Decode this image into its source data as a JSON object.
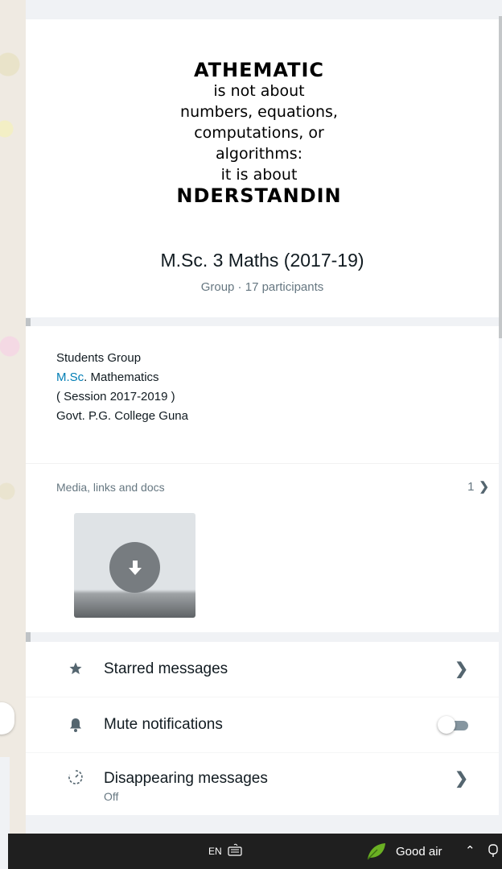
{
  "poster": {
    "line1": "ATHEMATIC",
    "line2": "is not about",
    "line3": "numbers, equations,",
    "line4": "computations, or",
    "line5": "algorithms:",
    "line6": "it is about",
    "line7": "NDERSTANDIN"
  },
  "group": {
    "title": "M.Sc. 3 Maths (2017-19)",
    "subtitle": "Group · 17 participants"
  },
  "description": {
    "line1": "Students Group",
    "line2_link": "M.Sc",
    "line2_rest": ". Mathematics",
    "line3": "( Session 2017-2019 )",
    "line4": "Govt. P.G. College Guna"
  },
  "media": {
    "label": "Media, links and docs",
    "count": "1",
    "thumb_icon": "download-icon"
  },
  "actions": {
    "starred_label": "Starred messages",
    "starred_icon": "star-icon",
    "mute_label": "Mute notifications",
    "mute_icon": "bell-icon",
    "mute_on": false,
    "disappearing_label": "Disappearing messages",
    "disappearing_sub": "Off",
    "disappearing_icon": "timer-icon"
  },
  "taskbar": {
    "language": "EN",
    "air_quality": "Good air",
    "colors": {
      "bar": "#1f1f1f",
      "leaf": "#6ab023"
    }
  },
  "colors": {
    "link": "#027eb5",
    "secondary_text": "#667781",
    "panel_bg": "#f0f2f5"
  }
}
